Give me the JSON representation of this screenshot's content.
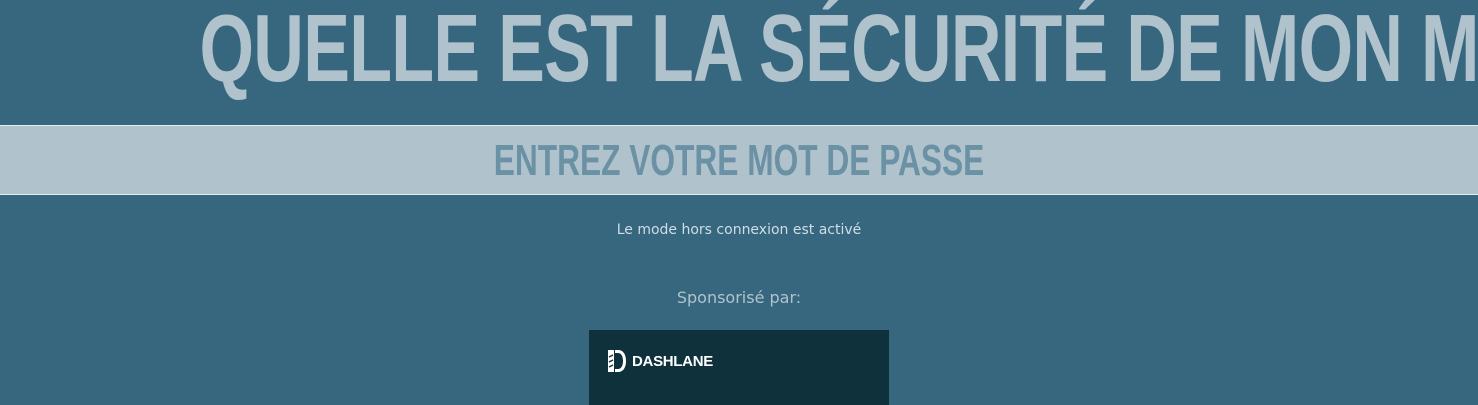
{
  "header": {
    "title": "QUELLE EST LA SÉCURITÉ DE MON MOT DE PASSE?"
  },
  "password_input": {
    "placeholder": "ENTREZ VOTRE MOT DE PASSE",
    "value": ""
  },
  "status": {
    "offline_message": "Le mode hors connexion est activé"
  },
  "sponsor": {
    "label": "Sponsorisé par:",
    "brand": "DASHLANE",
    "logo_icon": "dashlane-logo-icon"
  },
  "colors": {
    "background": "#37677f",
    "title": "#b0c3cd",
    "input_band": "#b0c3cd",
    "placeholder": "#6b91a4",
    "ad_background": "#0f313b"
  }
}
